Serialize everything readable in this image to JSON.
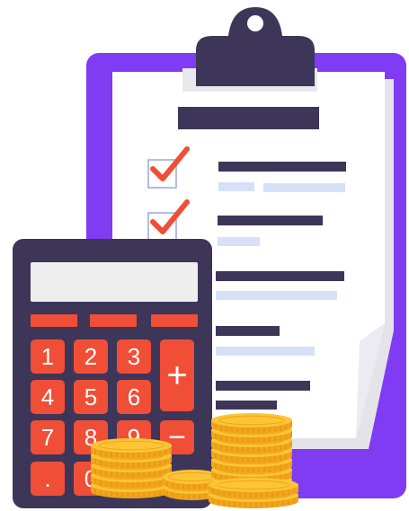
{
  "illustration": {
    "subject": "clipboard checklist with calculator and coin stacks",
    "colors": {
      "clipboard_board": "#7f3cf3",
      "paper": "#ffffff",
      "paper_shadow": "#e5e3ea",
      "clip": "#3d3659",
      "text_bar_dark": "#3d3659",
      "text_bar_light": "#d6e0f7",
      "checkmark": "#f04e37",
      "checkbox_border": "#9aa6d9",
      "calculator_body": "#3d3659",
      "calculator_screen": "#eeeeee",
      "calculator_keys": "#f04e37",
      "coin_fill": "#fdc536",
      "coin_edge": "#f0a51c"
    },
    "checklist": {
      "checked_items": 2,
      "total_items": 5
    },
    "calculator": {
      "keys": [
        "1",
        "2",
        "3",
        "4",
        "5",
        "6",
        "7",
        "8",
        "9",
        ".",
        "0",
        "=",
        "+",
        "−"
      ]
    },
    "coins": {
      "stacks": 4
    }
  }
}
